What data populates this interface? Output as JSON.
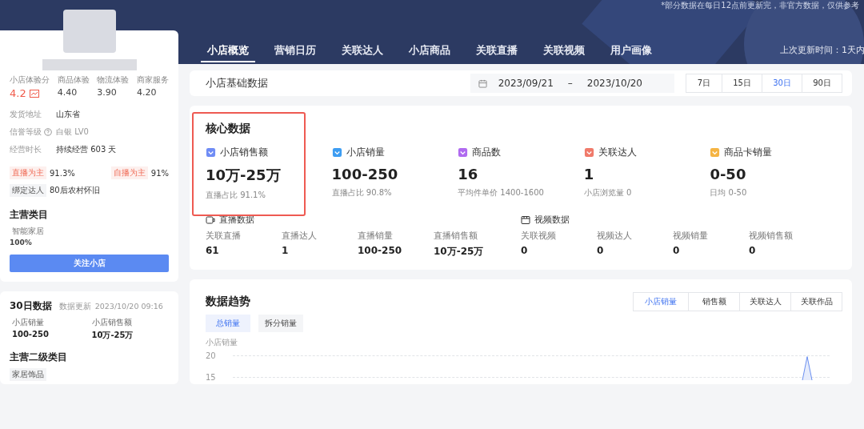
{
  "notice": "*部分数据在每日12点前更新完，非官方数据，仅供参考",
  "sidebar": {
    "scores": [
      {
        "label": "小店体验分",
        "value": "4.2",
        "kind": "main"
      },
      {
        "label": "商品体验",
        "value": "4.40",
        "kind": "plain"
      },
      {
        "label": "物流体验",
        "value": "3.90",
        "kind": "plain"
      },
      {
        "label": "商家服务",
        "value": "4.20",
        "kind": "plain"
      }
    ],
    "info": [
      {
        "label": "发货地址",
        "value": "山东省",
        "help": false
      },
      {
        "label": "信誉等级",
        "value": "白银 LV0",
        "help": true
      },
      {
        "label": "经营时长",
        "value": "持续经营 603 天",
        "help": false
      }
    ],
    "tags": [
      {
        "tag": "直播为主",
        "value": "91.3%",
        "kind": "accent"
      },
      {
        "tag": "自播为主",
        "value": "91%",
        "kind": "accent"
      },
      {
        "tag": "绑定达人",
        "value": "80后农村怀旧",
        "kind": "plain"
      }
    ],
    "category": {
      "title": "主营类目",
      "name": "智能家居",
      "share": "100%"
    },
    "follow_button": "关注小店",
    "month": {
      "title": "30日数据",
      "update_label": "数据更新",
      "update_time": "2023/10/20 09:16",
      "stats": [
        {
          "label": "小店销量",
          "value": "100-250"
        },
        {
          "label": "小店销售额",
          "value": "10万-25万"
        }
      ],
      "sub_title": "主营二级类目",
      "sub_tag": "家居饰品"
    }
  },
  "tabs": [
    {
      "label": "小店概览",
      "selected": true
    },
    {
      "label": "营销日历",
      "selected": false
    },
    {
      "label": "关联达人",
      "selected": false
    },
    {
      "label": "小店商品",
      "selected": false
    },
    {
      "label": "关联直播",
      "selected": false
    },
    {
      "label": "关联视频",
      "selected": false
    },
    {
      "label": "用户画像",
      "selected": false
    }
  ],
  "last_update": "上次更新时间：1天内",
  "basic": {
    "title": "小店基础数据",
    "date_from": "2023/09/21",
    "date_sep": "–",
    "date_to": "2023/10/20",
    "periods": [
      {
        "label": "7日",
        "selected": false
      },
      {
        "label": "15日",
        "selected": false
      },
      {
        "label": "30日",
        "selected": true
      },
      {
        "label": "90日",
        "selected": false
      }
    ]
  },
  "core": {
    "title": "核心数据",
    "highlight_first": true,
    "metrics": [
      {
        "label": "小店销售额",
        "value": "10万-25万",
        "note": "直播占比 91.1%"
      },
      {
        "label": "小店销量",
        "value": "100-250",
        "note": "直播占比 90.8%"
      },
      {
        "label": "商品数",
        "value": "16",
        "note": "平均件单价 1400-1600"
      },
      {
        "label": "关联达人",
        "value": "1",
        "note": "小店浏览量 0"
      },
      {
        "label": "商品卡销量",
        "value": "0-50",
        "note": "日均 0-50"
      }
    ],
    "groups": [
      {
        "title": "直播数据",
        "kind": "live",
        "items": [
          {
            "label": "关联直播",
            "value": "61"
          },
          {
            "label": "直播达人",
            "value": "1"
          },
          {
            "label": "直播销量",
            "value": "100-250"
          },
          {
            "label": "直播销售额",
            "value": "10万-25万"
          }
        ]
      },
      {
        "title": "视频数据",
        "kind": "video",
        "items": [
          {
            "label": "关联视频",
            "value": "0"
          },
          {
            "label": "视频达人",
            "value": "0"
          },
          {
            "label": "视频销量",
            "value": "0"
          },
          {
            "label": "视频销售额",
            "value": "0"
          }
        ]
      }
    ]
  },
  "trend": {
    "title": "数据趋势",
    "tabs": [
      {
        "label": "小店销量",
        "selected": true
      },
      {
        "label": "销售额",
        "selected": false
      },
      {
        "label": "关联达人",
        "selected": false
      },
      {
        "label": "关联作品",
        "selected": false
      }
    ],
    "sub_tabs": [
      {
        "label": "总销量",
        "selected": true
      },
      {
        "label": "拆分销量",
        "selected": false
      }
    ],
    "ylabel": "小店销量",
    "yticks": [
      "20",
      "15"
    ]
  }
}
